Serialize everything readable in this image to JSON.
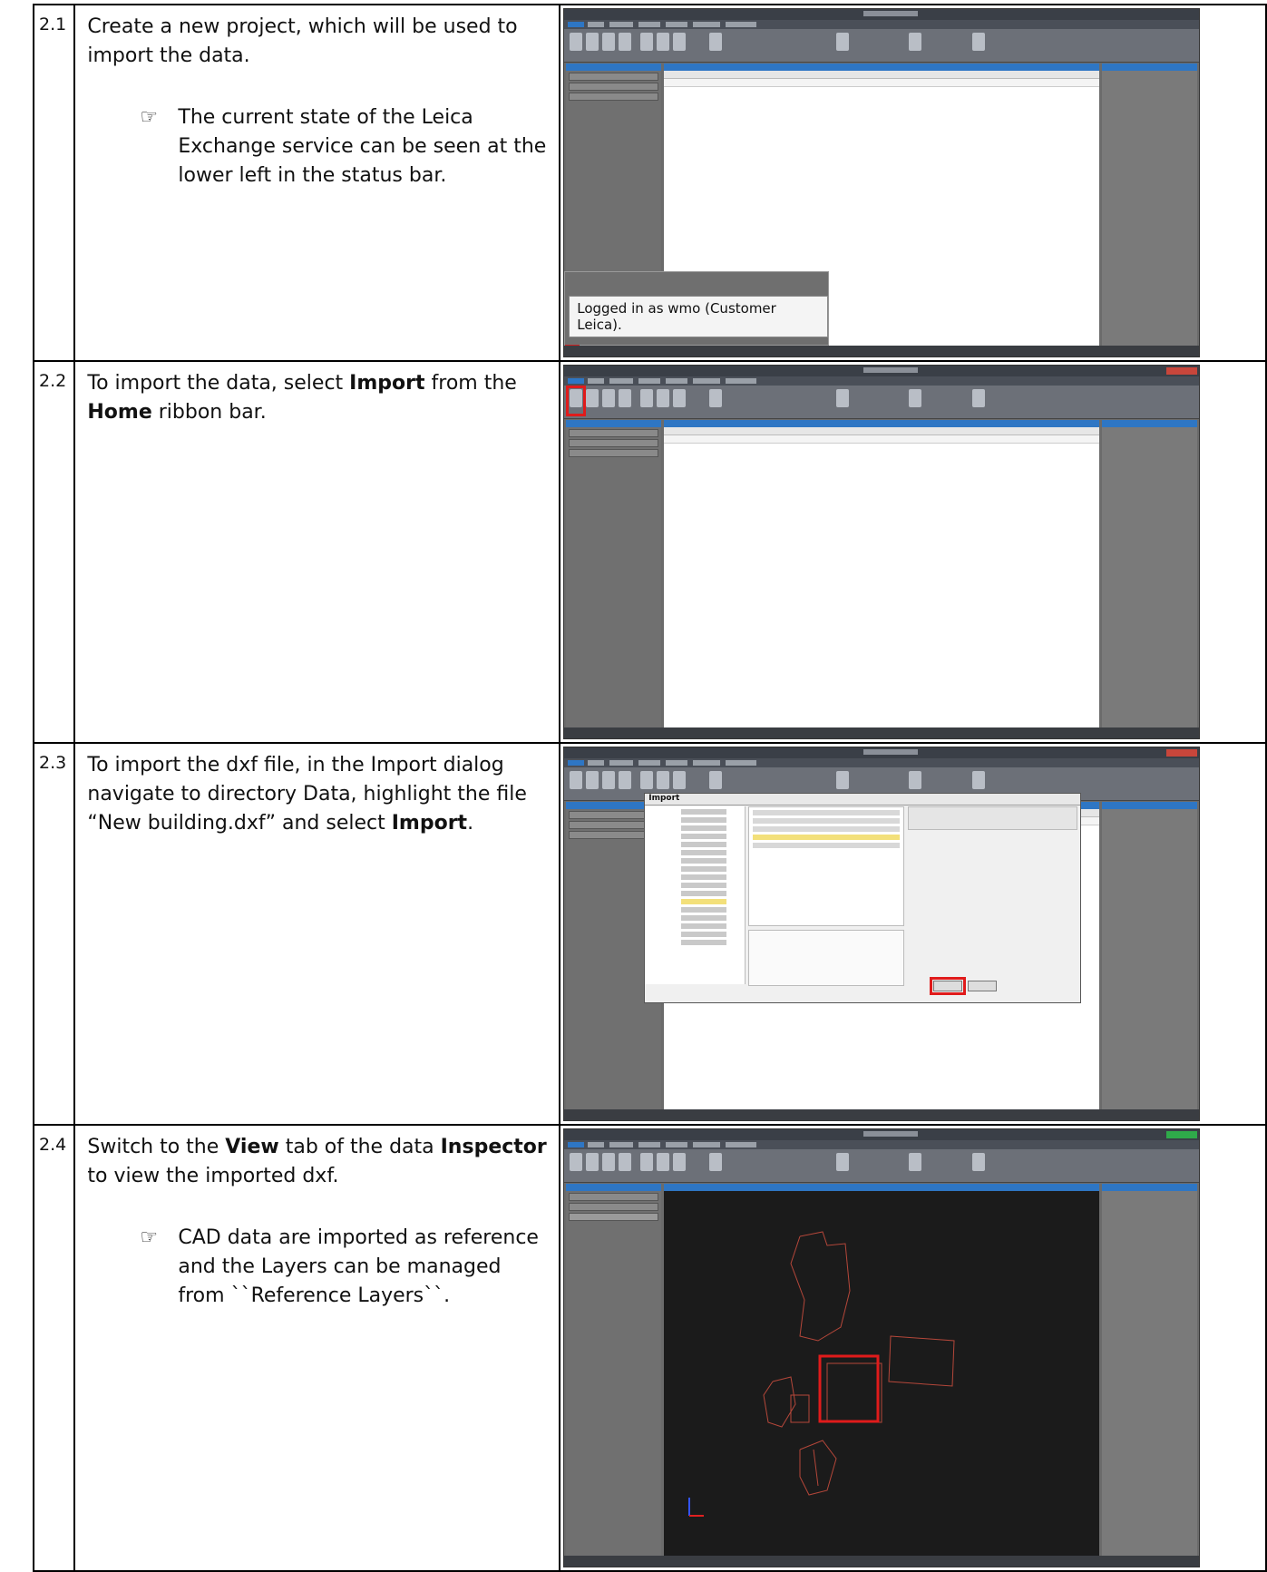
{
  "steps": [
    {
      "number": "2.1",
      "text_parts": [
        "Create a new project, which will be used to import the data."
      ],
      "note": "The current state of the Leica Exchange service can be seen at the lower left in the status bar.",
      "screenshot": {
        "popup_message": "Logged in as wmo (Customer Leica)."
      }
    },
    {
      "number": "2.2",
      "text_parts": [
        "To import the data, select ",
        "Import",
        " from the ",
        "Home",
        " ribbon bar."
      ]
    },
    {
      "number": "2.3",
      "text_parts": [
        "To import the dxf file, in the Import dialog navigate to directory Data, highlight the file “New building.dxf” and select ",
        "Import",
        "."
      ],
      "screenshot": {
        "dialog_title": "Import"
      }
    },
    {
      "number": "2.4",
      "text_parts": [
        "Switch to the ",
        "View",
        " tab of the data ",
        "Inspector",
        " to view the imported dxf."
      ],
      "note": "CAD data are imported as reference and the Layers can be managed from ``Reference Layers``."
    }
  ],
  "note_icon": "pointing-hand-icon",
  "colors": {
    "highlight_box": "#e01b1b",
    "ribbon_accent": "#2e76c4",
    "cad_lines": "#b5473a"
  }
}
